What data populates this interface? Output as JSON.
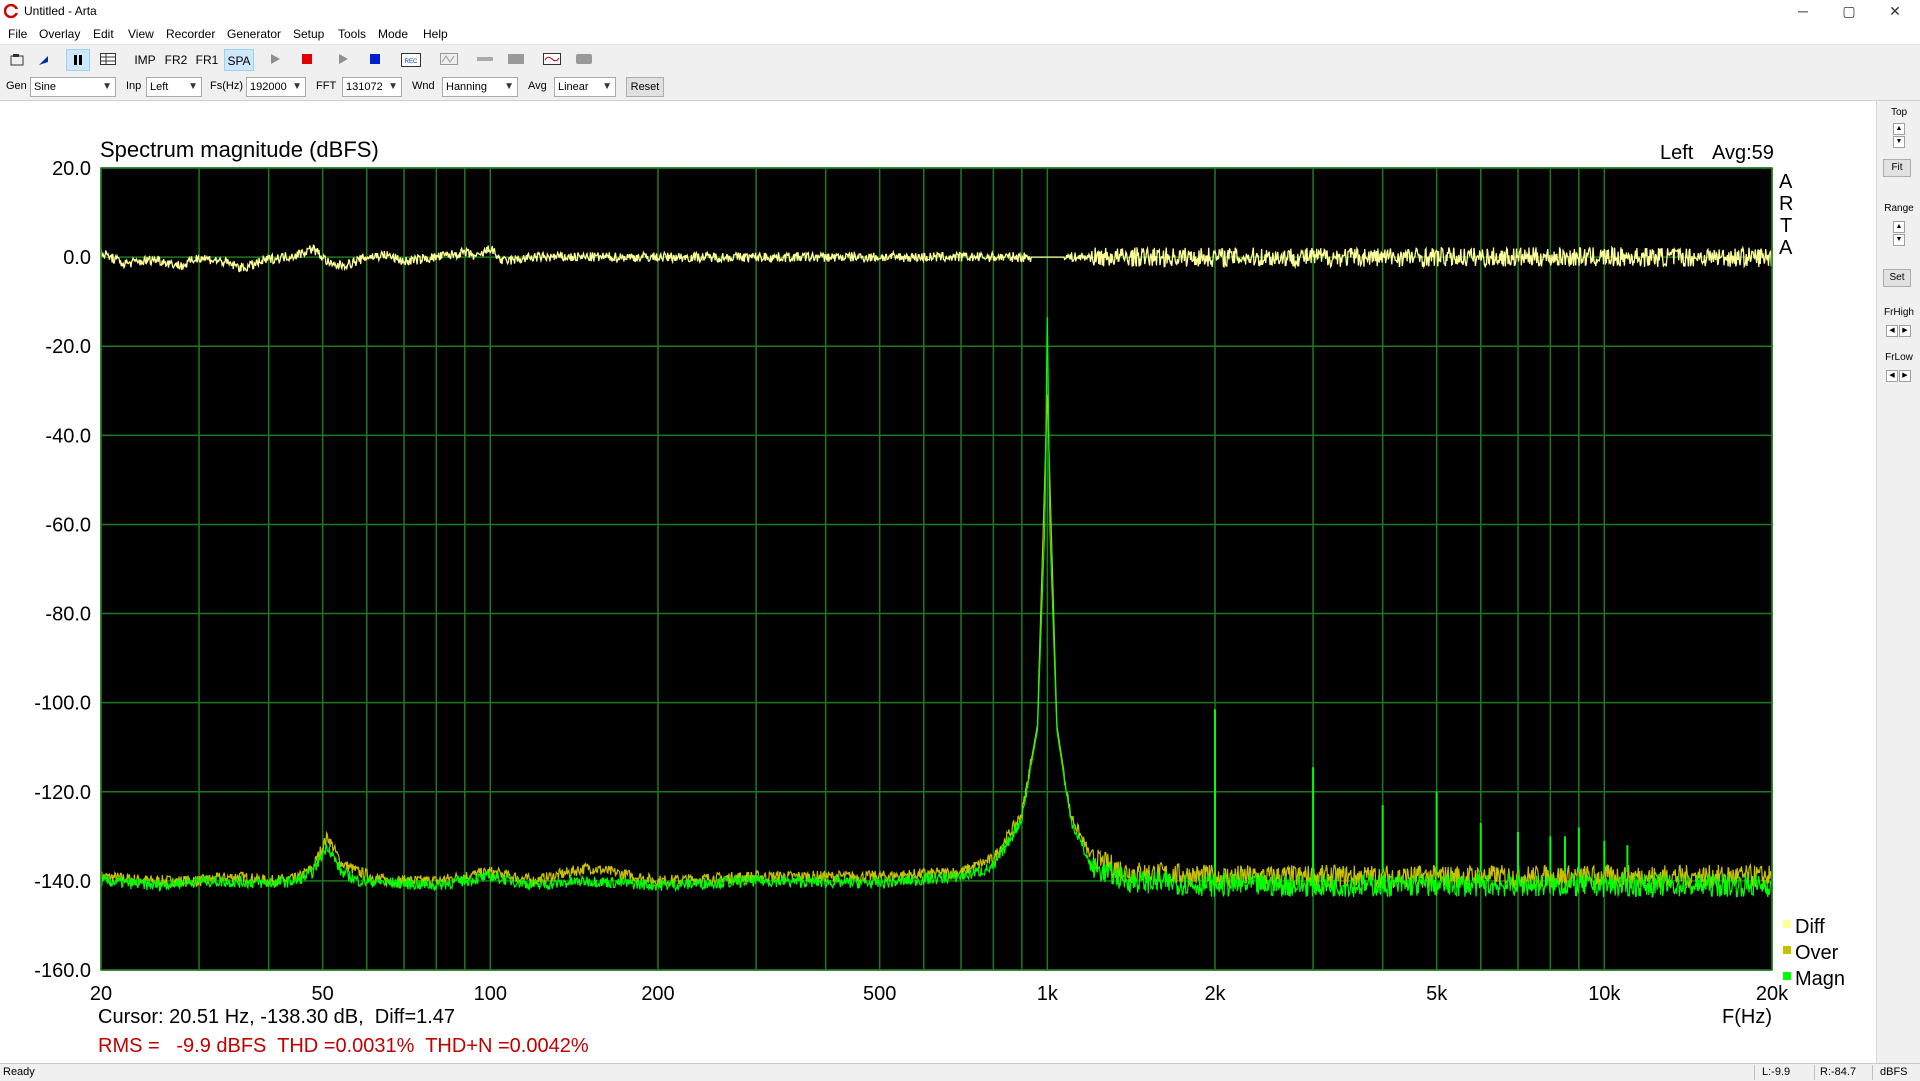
{
  "window": {
    "title": "Untitled - Arta",
    "minimize": "─",
    "maximize": "▢",
    "close": "✕"
  },
  "menu": [
    "File",
    "Overlay",
    "Edit",
    "View",
    "Recorder",
    "Generator",
    "Setup",
    "Tools",
    "Mode",
    "Help"
  ],
  "toolbar": {
    "imp": "IMP",
    "fr2": "FR2",
    "fr1": "FR1",
    "spa": "SPA",
    "active_mode": "SPA"
  },
  "controls": {
    "gen_label": "Gen",
    "gen_value": "Sine",
    "inp_label": "Inp",
    "inp_value": "Left",
    "fs_label": "Fs(Hz)",
    "fs_value": "192000",
    "fft_label": "FFT",
    "fft_value": "131072",
    "wnd_label": "Wnd",
    "wnd_value": "Hanning",
    "avg_label": "Avg",
    "avg_value": "Linear",
    "reset": "Reset"
  },
  "right_panel": {
    "top": "Top",
    "fit": "Fit",
    "range": "Range",
    "set": "Set",
    "frhigh": "FrHigh",
    "frlow": "FrLow"
  },
  "status": {
    "ready": "Ready",
    "l": "L:-9.9",
    "r": "R:-84.7",
    "unit": "dBFS"
  },
  "colors": {
    "plot_bg": "#000000",
    "grid": "#1e7a1e",
    "diff": "#ffff99",
    "over": "#c8c000",
    "magn": "#00ff00",
    "readout": "#c00000"
  },
  "chart_data": {
    "type": "line",
    "title": "Spectrum magnitude (dBFS)",
    "channel_label": "Left",
    "avg_label": "Avg:59",
    "side_label": [
      "A",
      "R",
      "T",
      "A"
    ],
    "xlabel": "F(Hz)",
    "xscale": "log",
    "xlim": [
      20,
      20000
    ],
    "ylim": [
      -160,
      20
    ],
    "grid": true,
    "legend_position": "bottom-right",
    "x_ticks": [
      {
        "value": 20,
        "label": "20"
      },
      {
        "value": 50,
        "label": "50"
      },
      {
        "value": 100,
        "label": "100"
      },
      {
        "value": 200,
        "label": "200"
      },
      {
        "value": 500,
        "label": "500"
      },
      {
        "value": 1000,
        "label": "1k"
      },
      {
        "value": 2000,
        "label": "2k"
      },
      {
        "value": 5000,
        "label": "5k"
      },
      {
        "value": 10000,
        "label": "10k"
      },
      {
        "value": 20000,
        "label": "20k"
      }
    ],
    "y_ticks": [
      {
        "value": 20,
        "label": "20.0"
      },
      {
        "value": 0,
        "label": "0.0"
      },
      {
        "value": -20,
        "label": "-20.0"
      },
      {
        "value": -40,
        "label": "-40.0"
      },
      {
        "value": -60,
        "label": "-60.0"
      },
      {
        "value": -80,
        "label": "-80.0"
      },
      {
        "value": -100,
        "label": "-100.0"
      },
      {
        "value": -120,
        "label": "-120.0"
      },
      {
        "value": -140,
        "label": "-140.0"
      },
      {
        "value": -160,
        "label": "-160.0"
      }
    ],
    "legend": [
      {
        "name": "Diff",
        "color": "#ffff99"
      },
      {
        "name": "Over",
        "color": "#c8c000"
      },
      {
        "name": "Magn",
        "color": "#00ff00"
      }
    ],
    "series": [
      {
        "name": "Diff",
        "color": "#ffff99",
        "points": [
          [
            20,
            1
          ],
          [
            22,
            -1.5
          ],
          [
            25,
            -0.5
          ],
          [
            28,
            -2
          ],
          [
            30,
            0
          ],
          [
            33,
            -1
          ],
          [
            36,
            -2.5
          ],
          [
            40,
            -0.5
          ],
          [
            45,
            0.5
          ],
          [
            48,
            2
          ],
          [
            52,
            -2
          ],
          [
            56,
            -1.5
          ],
          [
            60,
            0
          ],
          [
            65,
            0.5
          ],
          [
            70,
            -1
          ],
          [
            75,
            -0.5
          ],
          [
            80,
            0
          ],
          [
            90,
            1
          ],
          [
            95,
            0
          ],
          [
            100,
            2
          ],
          [
            105,
            -1
          ],
          [
            120,
            0
          ],
          [
            150,
            0
          ],
          [
            200,
            0
          ],
          [
            300,
            0
          ],
          [
            500,
            0
          ],
          [
            800,
            0
          ],
          [
            900,
            0
          ],
          [
            1000,
            0
          ],
          [
            1100,
            0
          ],
          [
            1500,
            0
          ],
          [
            2000,
            0
          ],
          [
            5000,
            0
          ],
          [
            10000,
            0
          ],
          [
            20000,
            0
          ]
        ]
      },
      {
        "name": "Over",
        "color": "#c8c000",
        "points": [
          [
            20,
            -139
          ],
          [
            25,
            -140
          ],
          [
            30,
            -140
          ],
          [
            35,
            -139
          ],
          [
            40,
            -140
          ],
          [
            45,
            -139.5
          ],
          [
            48,
            -137
          ],
          [
            51,
            -130
          ],
          [
            54,
            -136
          ],
          [
            58,
            -138
          ],
          [
            65,
            -140
          ],
          [
            80,
            -140
          ],
          [
            100,
            -138
          ],
          [
            120,
            -140
          ],
          [
            150,
            -137
          ],
          [
            200,
            -140
          ],
          [
            300,
            -139
          ],
          [
            500,
            -139
          ],
          [
            700,
            -138
          ],
          [
            800,
            -135
          ],
          [
            900,
            -125
          ],
          [
            960,
            -105
          ],
          [
            1000,
            -30
          ],
          [
            1040,
            -105
          ],
          [
            1100,
            -125
          ],
          [
            1200,
            -135
          ],
          [
            1400,
            -138
          ],
          [
            2000,
            -139
          ],
          [
            5000,
            -139
          ],
          [
            10000,
            -139
          ],
          [
            20000,
            -139
          ]
        ]
      },
      {
        "name": "Magn",
        "color": "#00ff00",
        "points": [
          [
            20,
            -140
          ],
          [
            25,
            -141
          ],
          [
            30,
            -140
          ],
          [
            40,
            -140.5
          ],
          [
            45,
            -140
          ],
          [
            48,
            -138
          ],
          [
            51,
            -132
          ],
          [
            54,
            -138
          ],
          [
            58,
            -140
          ],
          [
            80,
            -141
          ],
          [
            100,
            -139
          ],
          [
            120,
            -141
          ],
          [
            150,
            -140
          ],
          [
            200,
            -141
          ],
          [
            300,
            -140
          ],
          [
            500,
            -140.5
          ],
          [
            700,
            -139
          ],
          [
            800,
            -137
          ],
          [
            900,
            -126
          ],
          [
            960,
            -106
          ],
          [
            990,
            -60
          ],
          [
            1000,
            -11
          ],
          [
            1010,
            -60
          ],
          [
            1040,
            -106
          ],
          [
            1100,
            -126
          ],
          [
            1200,
            -137
          ],
          [
            1400,
            -140
          ],
          [
            2000,
            -141
          ],
          [
            5000,
            -141
          ],
          [
            10000,
            -141
          ],
          [
            20000,
            -141
          ]
        ]
      }
    ],
    "harmonics_magn": [
      {
        "f": 2000,
        "db": -101.5
      },
      {
        "f": 3000,
        "db": -114.5
      },
      {
        "f": 4000,
        "db": -123
      },
      {
        "f": 5000,
        "db": -120
      },
      {
        "f": 6000,
        "db": -127
      },
      {
        "f": 7000,
        "db": -129
      },
      {
        "f": 8000,
        "db": -130
      },
      {
        "f": 8500,
        "db": -130
      },
      {
        "f": 9000,
        "db": -128
      },
      {
        "f": 10000,
        "db": -131
      },
      {
        "f": 11000,
        "db": -132
      }
    ],
    "cursor_text": "Cursor: 20.51 Hz, -138.30 dB,  Diff=1.47",
    "readout_text": "RMS =   -9.9 dBFS  THD =0.0031%  THD+N =0.0042%"
  }
}
